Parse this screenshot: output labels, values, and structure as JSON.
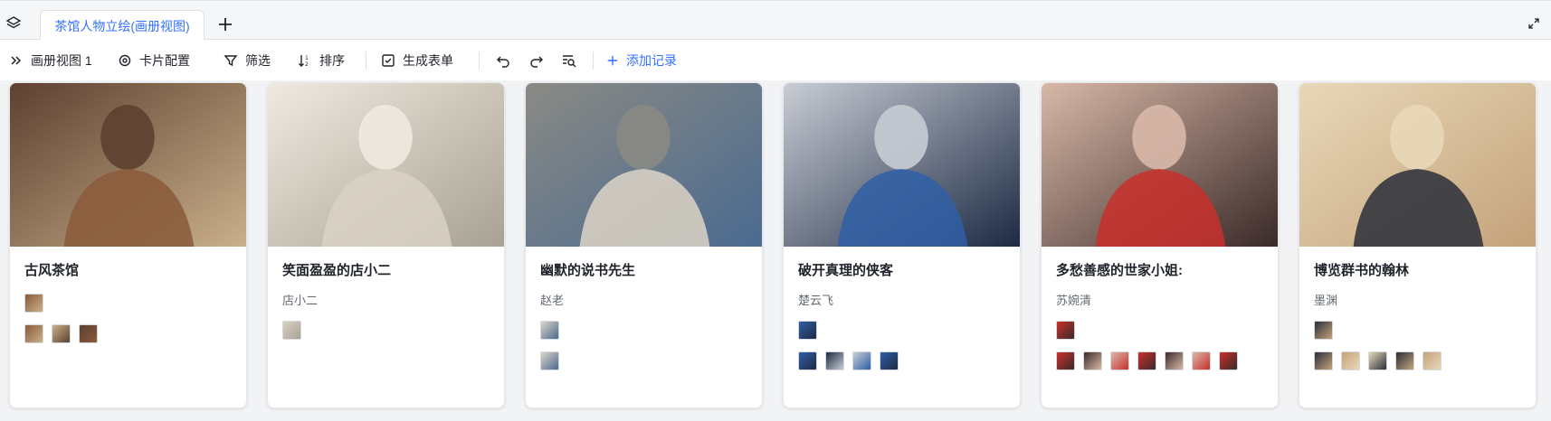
{
  "tabbar": {
    "active_tab": "茶馆人物立绘(画册视图)",
    "layers_icon": "layers-icon",
    "add_icon": "plus-icon",
    "expand_icon": "expand-icon"
  },
  "toolbar": {
    "view_name": "画册视图 1",
    "card_config": "卡片配置",
    "filter": "筛选",
    "sort": "排序",
    "generate_form": "生成表单",
    "add_record": "添加记录"
  },
  "colors": {
    "accent": "#3370ff",
    "text": "#1f2329",
    "secondary": "#646a73"
  },
  "cards": [
    {
      "title": "古风茶馆",
      "subtitle": "",
      "row1_count": 1,
      "row2_count": 3,
      "palette": [
        "#8a5a3a",
        "#c9b08a",
        "#5d4030"
      ]
    },
    {
      "title": "笑面盈盈的店小二",
      "subtitle": "店小二",
      "row1_count": 1,
      "row2_count": 0,
      "palette": [
        "#d9d2c4",
        "#a8a294",
        "#efe9df"
      ]
    },
    {
      "title": "幽默的说书先生",
      "subtitle": "赵老",
      "row1_count": 1,
      "row2_count": 1,
      "palette": [
        "#ddd5c7",
        "#4a6a90",
        "#8a8a84"
      ]
    },
    {
      "title": "破开真理的侠客",
      "subtitle": "楚云飞",
      "row1_count": 1,
      "row2_count": 4,
      "palette": [
        "#2f5fa6",
        "#1d2a44",
        "#c8ccd4"
      ]
    },
    {
      "title": "多愁善感的世家小姐:",
      "subtitle": "苏婉清",
      "row1_count": 1,
      "row2_count": 7,
      "palette": [
        "#c9302c",
        "#3a2a28",
        "#d8b8a8"
      ]
    },
    {
      "title": "博览群书的翰林",
      "subtitle": "墨渊",
      "row1_count": 1,
      "row2_count": 5,
      "palette": [
        "#2a2f3a",
        "#c4a27a",
        "#e8d8b8"
      ]
    }
  ]
}
